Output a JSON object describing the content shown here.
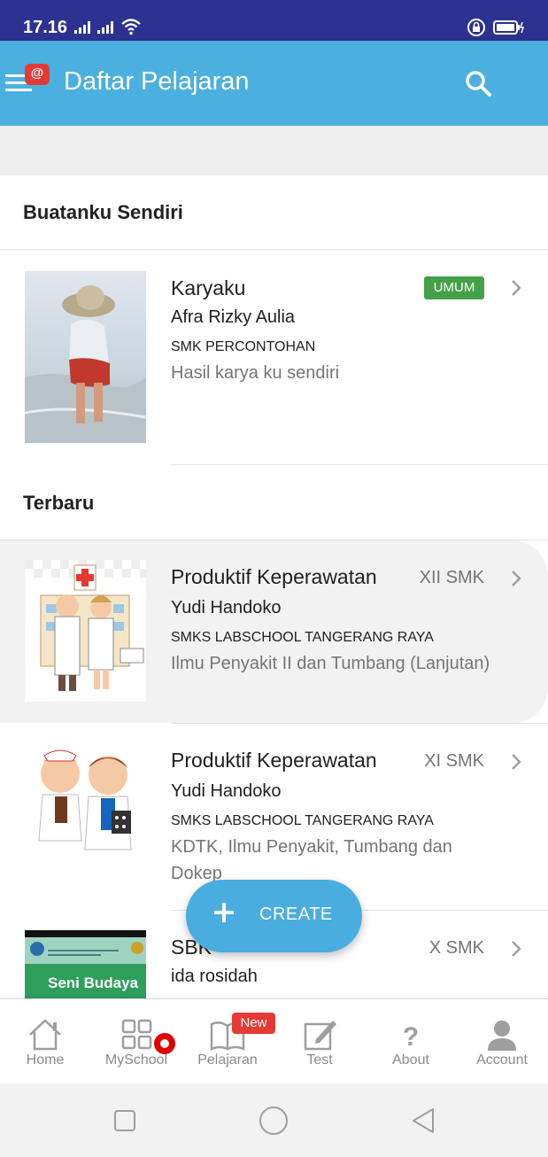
{
  "status_bar": {
    "time": "17.16",
    "colors": {
      "background": "#2d3190"
    }
  },
  "app_bar": {
    "title": "Daftar Pelajaran",
    "menu_badge": "@",
    "colors": {
      "background": "#4bb0df"
    }
  },
  "sections": {
    "own": "Buatanku Sendiri",
    "latest": "Terbaru"
  },
  "own_items": [
    {
      "title": "Karyaku",
      "badge": "UMUM",
      "author": "Afra Rizky Aulia",
      "school": "SMK PERCONTOHAN",
      "description": "Hasil karya ku sendiri"
    }
  ],
  "latest_items": [
    {
      "title": "Produktif Keperawatan",
      "grade": "XII SMK",
      "author": "Yudi Handoko",
      "school": "SMKS LABSCHOOL TANGERANG RAYA",
      "description": "Ilmu Penyakit II dan Tumbang (Lanjutan)"
    },
    {
      "title": "Produktif Keperawatan",
      "grade": "XI SMK",
      "author": "Yudi Handoko",
      "school": "SMKS LABSCHOOL TANGERANG RAYA",
      "description": "KDTK, Ilmu Penyakit, Tumbang dan Dokep"
    },
    {
      "title": "SBK",
      "grade": "X SMK",
      "author": "ida rosidah",
      "thumb_text": "Seni Budaya"
    }
  ],
  "fab": {
    "label": "CREATE",
    "icon": "plus-icon"
  },
  "bottom_nav": {
    "items": [
      {
        "label": "Home",
        "icon": "home-icon"
      },
      {
        "label": "MySchool",
        "icon": "grid-icon"
      },
      {
        "label": "Pelajaran",
        "icon": "book-icon"
      },
      {
        "label": "Test",
        "icon": "edit-icon"
      },
      {
        "label": "About",
        "icon": "question-icon"
      },
      {
        "label": "Account",
        "icon": "person-icon"
      }
    ],
    "new_badge": "New"
  }
}
